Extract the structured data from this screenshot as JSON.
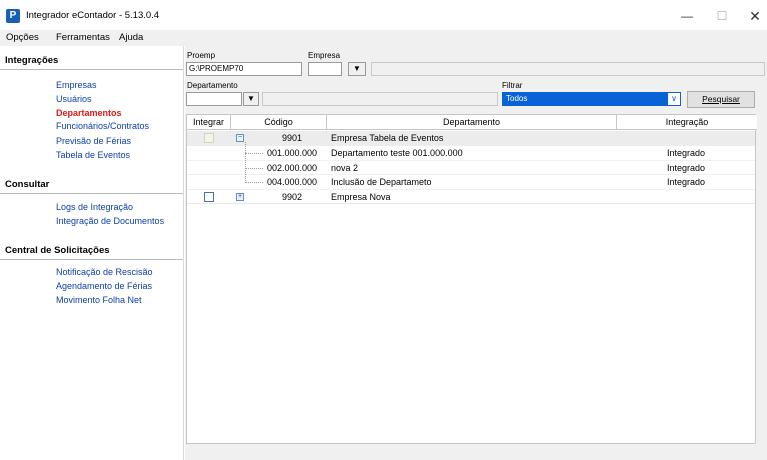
{
  "window": {
    "title": "Integrador eContador - 5.13.0.4",
    "app_icon_glyph": "P",
    "minimize": "—",
    "maximize": "☐",
    "close": "✕"
  },
  "menu": [
    "Opções",
    "Ferramentas",
    "Ajuda"
  ],
  "sidebar": {
    "sections": [
      {
        "title": "Integrações",
        "items": [
          "Empresas",
          "Usuários",
          "Departamentos",
          "Funcionários/Contratos",
          "Previsão de Férias",
          "Tabela de Eventos"
        ],
        "active_index": 2
      },
      {
        "title": "Consultar",
        "items": [
          "Logs de Integração",
          "Integração de Documentos"
        ]
      },
      {
        "title": "Central de Solicitações",
        "items": [
          "Notificação de Rescisão",
          "Agendamento de Férias",
          "Movimento Folha Net"
        ]
      }
    ]
  },
  "filters": {
    "proemp_label": "Proemp",
    "proemp_value": "G:\\PROEMP70",
    "empresa_label": "Empresa",
    "empresa_value": "",
    "departamento_label": "Departamento",
    "departamento_value": "",
    "filtrar_label": "Filtrar",
    "filtrar_value": "Todos",
    "search_button": "Pesquisar"
  },
  "grid": {
    "columns": [
      "Integrar",
      "Código",
      "Departamento",
      "Integração"
    ],
    "rows": [
      {
        "level": 0,
        "expander": "−",
        "codigo": "9901",
        "departamento": "Empresa Tabela de Eventos",
        "integracao": "",
        "checkbox_disabled": true
      },
      {
        "level": 1,
        "codigo": "001.000.000",
        "departamento": "Departamento teste 001.000.000",
        "integracao": "Integrado"
      },
      {
        "level": 1,
        "codigo": "002.000.000",
        "departamento": "nova 2",
        "integracao": "Integrado"
      },
      {
        "level": 1,
        "codigo": "004.000.000",
        "departamento": "Inclusão de Departameto",
        "integracao": "Integrado"
      },
      {
        "level": 0,
        "expander": "+",
        "codigo": "9902",
        "departamento": "Empresa Nova",
        "integracao": "",
        "checkbox_disabled": false
      }
    ]
  },
  "icons": {
    "dropdown": "chevron-down-icon",
    "expand": "plus-icon",
    "collapse": "minus-icon"
  },
  "colors": {
    "active_link": "#e01818",
    "link": "#0b3ea8",
    "selection": "#0a63d6"
  }
}
